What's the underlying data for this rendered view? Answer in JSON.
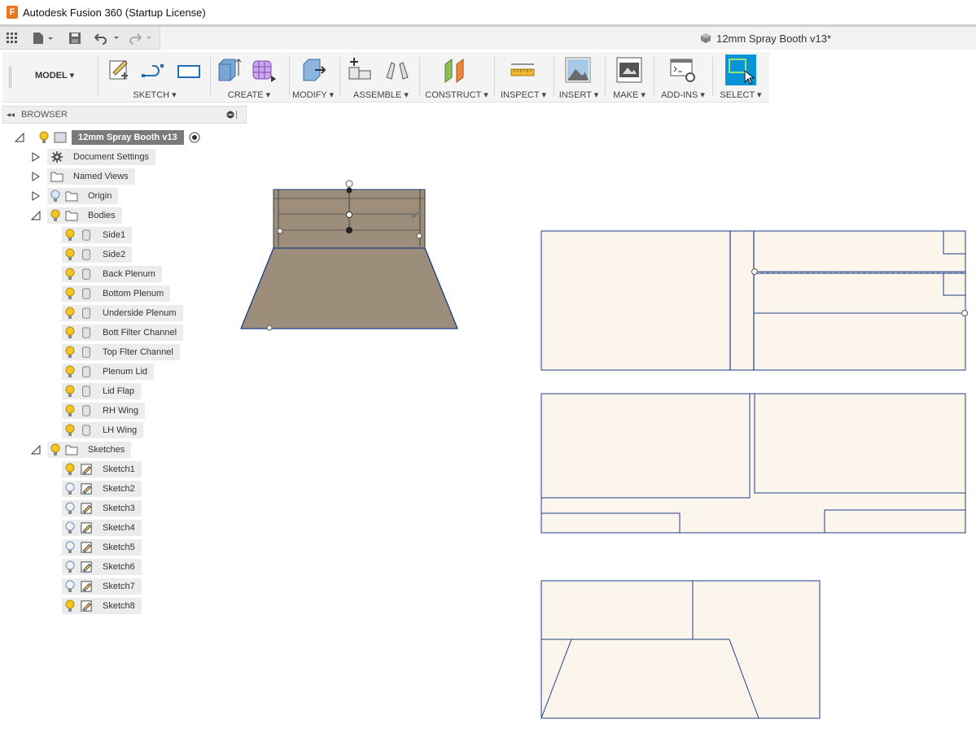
{
  "window": {
    "title": "Autodesk Fusion 360 (Startup License)",
    "app_logo": "F"
  },
  "document_tab": {
    "name": "12mm Spray Booth v13*"
  },
  "toolbar": {
    "workspace": "MODEL ▾",
    "groups": {
      "sketch": "SKETCH ▾",
      "create": "CREATE ▾",
      "modify": "MODIFY ▾",
      "assemble": "ASSEMBLE ▾",
      "construct": "CONSTRUCT ▾",
      "inspect": "INSPECT ▾",
      "insert": "INSERT ▾",
      "make": "MAKE ▾",
      "addins": "ADD-INS ▾",
      "select": "SELECT ▾"
    }
  },
  "browser": {
    "title": "BROWSER",
    "root": "12mm Spray Booth v13",
    "document_settings": "Document Settings",
    "named_views": "Named Views",
    "origin": "Origin",
    "bodies_folder": "Bodies",
    "bodies": [
      "Side1",
      "Side2",
      "Back Plenum",
      "Bottom Plenum",
      "Underside Plenum",
      "Bott Filter Channel",
      "Top Flter Channel",
      "Plenum Lid",
      "Lid Flap",
      "RH Wing",
      "LH Wing"
    ],
    "sketches_folder": "Sketches",
    "sketches": [
      "Sketch1",
      "Sketch2",
      "Sketch3",
      "Sketch4",
      "Sketch5",
      "Sketch6",
      "Sketch7",
      "Sketch8"
    ],
    "sketch_visible": [
      true,
      false,
      false,
      false,
      false,
      false,
      false,
      true
    ]
  },
  "colors": {
    "accent": "#0696d7",
    "sketch_line": "#1f3f8a",
    "sheet_fill": "#fbf5ec",
    "body_fill": "#9c8e7a",
    "bulb_on": "#f3c623",
    "bulb_off": "#9fb7d3"
  }
}
